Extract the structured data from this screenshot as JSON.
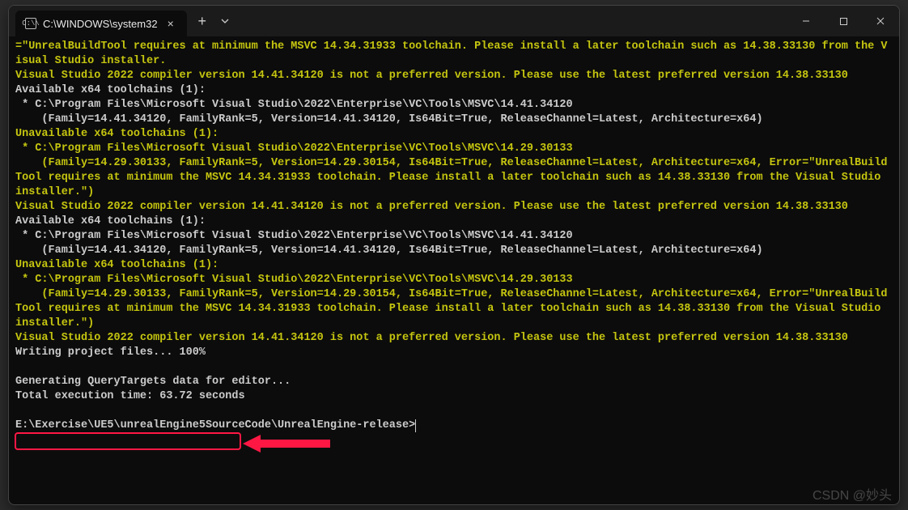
{
  "titlebar": {
    "tab_title": "C:\\WINDOWS\\system32",
    "new_tab_label": "+",
    "close_tab_label": "×"
  },
  "terminal": {
    "lines": [
      {
        "cls": "y",
        "text": "=\"UnrealBuildTool requires at minimum the MSVC 14.34.31933 toolchain. Please install a later toolchain such as 14.38.33130 from the Visual Studio installer."
      },
      {
        "cls": "y",
        "text": "Visual Studio 2022 compiler version 14.41.34120 is not a preferred version. Please use the latest preferred version 14.38.33130"
      },
      {
        "cls": "w",
        "text": "Available x64 toolchains (1):"
      },
      {
        "cls": "w",
        "text": " * C:\\Program Files\\Microsoft Visual Studio\\2022\\Enterprise\\VC\\Tools\\MSVC\\14.41.34120"
      },
      {
        "cls": "w",
        "text": "    (Family=14.41.34120, FamilyRank=5, Version=14.41.34120, Is64Bit=True, ReleaseChannel=Latest, Architecture=x64)"
      },
      {
        "cls": "y",
        "text": "Unavailable x64 toolchains (1):"
      },
      {
        "cls": "y",
        "text": " * C:\\Program Files\\Microsoft Visual Studio\\2022\\Enterprise\\VC\\Tools\\MSVC\\14.29.30133"
      },
      {
        "cls": "y",
        "text": "    (Family=14.29.30133, FamilyRank=5, Version=14.29.30154, Is64Bit=True, ReleaseChannel=Latest, Architecture=x64, Error=\"UnrealBuildTool requires at minimum the MSVC 14.34.31933 toolchain. Please install a later toolchain such as 14.38.33130 from the Visual Studio installer.\")"
      },
      {
        "cls": "y",
        "text": "Visual Studio 2022 compiler version 14.41.34120 is not a preferred version. Please use the latest preferred version 14.38.33130"
      },
      {
        "cls": "w",
        "text": "Available x64 toolchains (1):"
      },
      {
        "cls": "w",
        "text": " * C:\\Program Files\\Microsoft Visual Studio\\2022\\Enterprise\\VC\\Tools\\MSVC\\14.41.34120"
      },
      {
        "cls": "w",
        "text": "    (Family=14.41.34120, FamilyRank=5, Version=14.41.34120, Is64Bit=True, ReleaseChannel=Latest, Architecture=x64)"
      },
      {
        "cls": "y",
        "text": "Unavailable x64 toolchains (1):"
      },
      {
        "cls": "y",
        "text": " * C:\\Program Files\\Microsoft Visual Studio\\2022\\Enterprise\\VC\\Tools\\MSVC\\14.29.30133"
      },
      {
        "cls": "y",
        "text": "    (Family=14.29.30133, FamilyRank=5, Version=14.29.30154, Is64Bit=True, ReleaseChannel=Latest, Architecture=x64, Error=\"UnrealBuildTool requires at minimum the MSVC 14.34.31933 toolchain. Please install a later toolchain such as 14.38.33130 from the Visual Studio installer.\")"
      },
      {
        "cls": "y",
        "text": "Visual Studio 2022 compiler version 14.41.34120 is not a preferred version. Please use the latest preferred version 14.38.33130"
      },
      {
        "cls": "w",
        "text": "Writing project files... 100%"
      },
      {
        "cls": "w",
        "text": ""
      },
      {
        "cls": "w",
        "text": "Generating QueryTargets data for editor..."
      },
      {
        "cls": "w",
        "text": "Total execution time: 63.72 seconds"
      },
      {
        "cls": "w",
        "text": ""
      }
    ],
    "prompt": "E:\\Exercise\\UE5\\unrealEngine5SourceCode\\UnrealEngine-release>"
  },
  "watermark": "CSDN @妙头"
}
